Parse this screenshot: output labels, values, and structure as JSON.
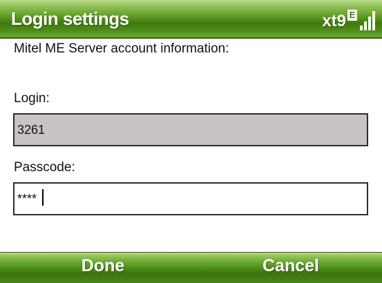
{
  "header": {
    "title": "Login settings",
    "input_mode": "xt9",
    "network_badge": "E",
    "signal_icon": "signal-strength-icon"
  },
  "form": {
    "section_heading": "Mitel ME Server account information:",
    "login_label": "Login:",
    "login_value": "3261",
    "passcode_label": "Passcode:",
    "passcode_value": "****"
  },
  "softkeys": {
    "left_label": "Done",
    "right_label": "Cancel"
  },
  "colors": {
    "accent_green": "#4c8a18",
    "readonly_field_bg": "#c8c3c6"
  }
}
